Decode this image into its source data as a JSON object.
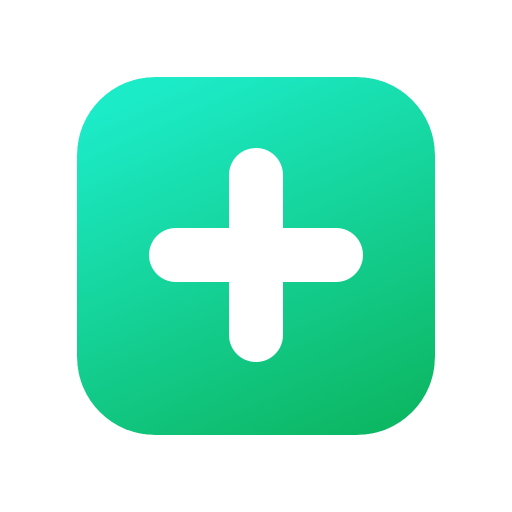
{
  "icon": {
    "name": "plus-icon",
    "gradient_start": "#1CEBC8",
    "gradient_end": "#0DB865",
    "glyph_color": "#FFFFFF"
  }
}
